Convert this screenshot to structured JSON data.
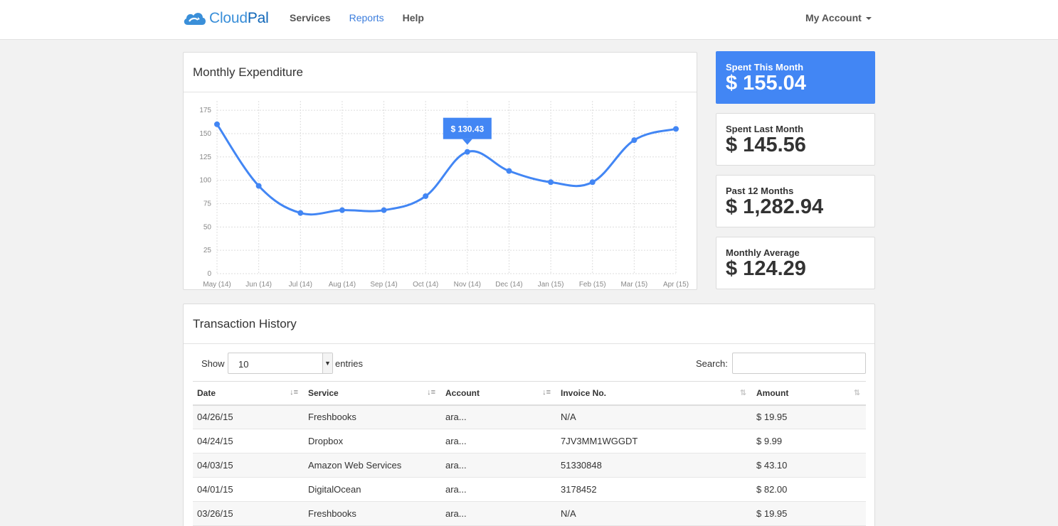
{
  "nav": {
    "brand_part1": "Cloud",
    "brand_part2": "Pal",
    "links": [
      "Services",
      "Reports",
      "Help"
    ],
    "active_link": "Reports",
    "account_label": "My Account"
  },
  "expenditure": {
    "title": "Monthly Expenditure",
    "tooltip": "$ 130.43"
  },
  "chart_data": {
    "type": "line",
    "categories": [
      "May (14)",
      "Jun (14)",
      "Jul (14)",
      "Aug (14)",
      "Sep (14)",
      "Oct (14)",
      "Nov (14)",
      "Dec (14)",
      "Jan (15)",
      "Feb (15)",
      "Mar (15)",
      "Apr (15)"
    ],
    "series": [
      {
        "values": [
          160,
          94,
          65,
          68,
          68,
          83,
          130.43,
          110,
          98,
          98,
          143,
          155.04
        ]
      }
    ],
    "yticks": [
      0,
      25,
      50,
      75,
      100,
      125,
      150,
      175
    ],
    "ylim": [
      0,
      185
    ],
    "grid": true,
    "highlight_index": 6,
    "color": "#4286f4"
  },
  "stats": [
    {
      "label": "Spent This Month",
      "value": "$ 155.04"
    },
    {
      "label": "Spent Last Month",
      "value": "$ 145.56"
    },
    {
      "label": "Past 12 Months",
      "value": "$ 1,282.94"
    },
    {
      "label": "Monthly Average",
      "value": "$ 124.29"
    }
  ],
  "history": {
    "title": "Transaction History",
    "show_label": "Show",
    "entries_value": "10",
    "entries_label": "entries",
    "search_label": "Search:",
    "columns": [
      "Date",
      "Service",
      "Account",
      "Invoice No.",
      "Amount"
    ],
    "rows": [
      [
        "04/26/15",
        "Freshbooks",
        "ara...",
        "N/A",
        "$ 19.95"
      ],
      [
        "04/24/15",
        "Dropbox",
        "ara...",
        "7JV3MM1WGGDT",
        "$ 9.99"
      ],
      [
        "04/03/15",
        "Amazon Web Services",
        "ara...",
        "51330848",
        "$ 43.10"
      ],
      [
        "04/01/15",
        "DigitalOcean",
        "ara...",
        "3178452",
        "$ 82.00"
      ],
      [
        "03/26/15",
        "Freshbooks",
        "ara...",
        "N/A",
        "$ 19.95"
      ]
    ]
  }
}
